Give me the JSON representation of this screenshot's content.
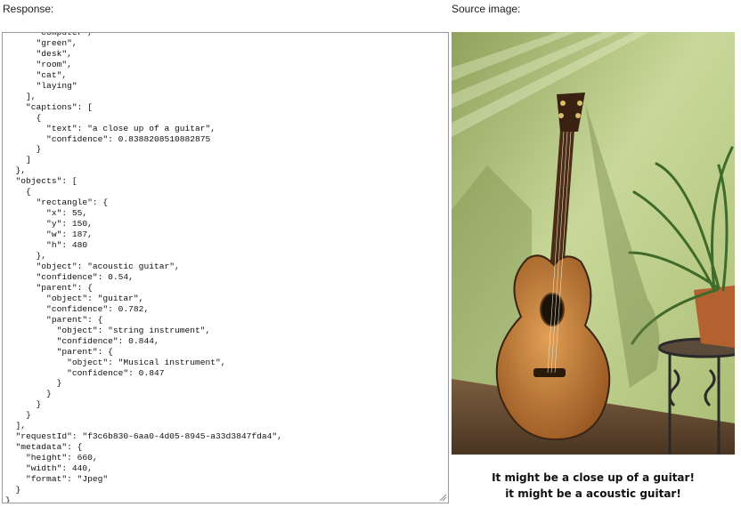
{
  "labels": {
    "response": "Response:",
    "source": "Source image:"
  },
  "response_json": "      \"computer\",\n      \"green\",\n      \"desk\",\n      \"room\",\n      \"cat\",\n      \"laying\"\n    ],\n    \"captions\": [\n      {\n        \"text\": \"a close up of a guitar\",\n        \"confidence\": 0.8388208510882875\n      }\n    ]\n  },\n  \"objects\": [\n    {\n      \"rectangle\": {\n        \"x\": 55,\n        \"y\": 150,\n        \"w\": 187,\n        \"h\": 480\n      },\n      \"object\": \"acoustic guitar\",\n      \"confidence\": 0.54,\n      \"parent\": {\n        \"object\": \"guitar\",\n        \"confidence\": 0.782,\n        \"parent\": {\n          \"object\": \"string instrument\",\n          \"confidence\": 0.844,\n          \"parent\": {\n            \"object\": \"Musical instrument\",\n            \"confidence\": 0.847\n          }\n        }\n      }\n    }\n  ],\n  \"requestId\": \"f3c6b830-6aa0-4d05-8945-a33d3847fda4\",\n  \"metadata\": {\n    \"height\": 660,\n    \"width\": 440,\n    \"format\": \"Jpeg\"\n  }\n}",
  "captions": {
    "line1": "It might be a close up of a guitar!",
    "line2": "it might be a acoustic guitar!"
  },
  "colors": {
    "wall": "#c3d38f",
    "floor": "#6b5238",
    "guitar_body": "#c7803e",
    "plant": "#3f6a2a"
  }
}
